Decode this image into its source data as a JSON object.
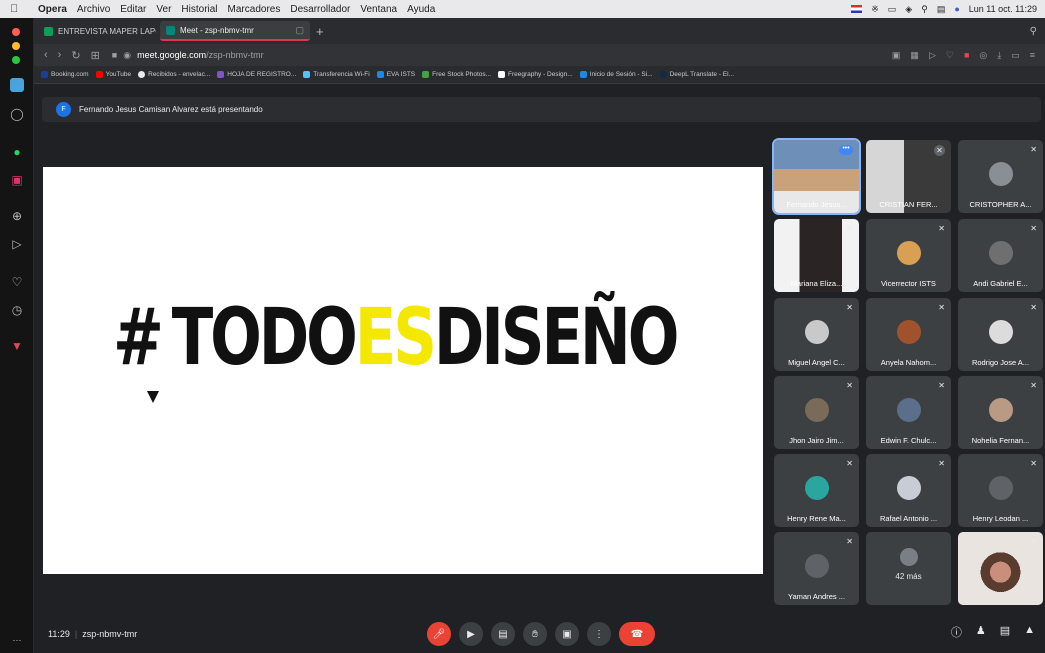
{
  "menubar": {
    "app": "Opera",
    "items": [
      "Archivo",
      "Editar",
      "Ver",
      "Historial",
      "Marcadores",
      "Desarrollador",
      "Ventana",
      "Ayuda"
    ],
    "clock": "Lun 11 oct.  11:29"
  },
  "tabs": [
    {
      "label": "ENTREVISTA MAPER LAPO - G",
      "active": false
    },
    {
      "label": "Meet - zsp-nbmv-tmr",
      "active": true
    }
  ],
  "address": {
    "host": "meet.google.com",
    "path": "/zsp-nbmv-tmr"
  },
  "bookmarks": [
    "Booking.com",
    "YouTube",
    "Recibidos - envelac...",
    "HOJA DE REGISTRO...",
    "Transferencia Wi-Fi",
    "EVA ISTS",
    "Free Stock Photos...",
    "Freegraphy - Design...",
    "Inicio de Sesión - Si...",
    "DeepL Translate - El..."
  ],
  "banner": {
    "initial": "F",
    "text": "Fernando Jesus Camisan Alvarez está presentando"
  },
  "slide": {
    "hash": "#",
    "part1": "TODO",
    "part2": "ES",
    "part3": "DISEÑO"
  },
  "participants": [
    {
      "name": "Fernando Jesus...",
      "type": "video-male",
      "more": "•••"
    },
    {
      "name": "CRISTIAN FER...",
      "type": "video-dark"
    },
    {
      "name": "CRISTOPHER A...",
      "type": "avatar",
      "color": "#8a8f95"
    },
    {
      "name": "Mariana Eliza...",
      "type": "video-female"
    },
    {
      "name": "Vicerrector ISTS",
      "type": "avatar",
      "color": "#d9a055"
    },
    {
      "name": "Andi Gabriel E...",
      "type": "avatar",
      "color": "#6f6f6f"
    },
    {
      "name": "Miguel Angel C...",
      "type": "avatar",
      "color": "#c9c9c9"
    },
    {
      "name": "Anyela Nahom...",
      "type": "avatar",
      "color": "#a0522d"
    },
    {
      "name": "Rodrigo Jose A...",
      "type": "avatar",
      "color": "#dcdcdc"
    },
    {
      "name": "Jhon Jairo Jim...",
      "type": "avatar",
      "color": "#7a6a5a"
    },
    {
      "name": "Edwin F. Chulc...",
      "type": "avatar",
      "color": "#5b6f8a"
    },
    {
      "name": "Nohelia Fernan...",
      "type": "avatar",
      "color": "#b99a85"
    },
    {
      "name": "Henry Rene Ma...",
      "type": "avatar",
      "color": "#2aa5a0"
    },
    {
      "name": "Rafael Antonio ...",
      "type": "avatar",
      "color": "#c8ccd4"
    },
    {
      "name": "Henry Leodan ...",
      "type": "avatar",
      "color": "#5f6368"
    },
    {
      "name": "Yaman Andres ...",
      "type": "avatar",
      "color": "#5f6368"
    },
    {
      "name": "",
      "type": "overflow",
      "count": "42 más"
    },
    {
      "name": "",
      "type": "video-self"
    }
  ],
  "bottombar": {
    "time": "11:29",
    "code": "zsp-nbmv-tmr"
  },
  "colors": {
    "accent_red": "#ea4335",
    "meet_bg": "#202124",
    "tile_bg": "#3c4043",
    "highlight_yellow": "#f5e800"
  },
  "icons": {
    "mic_off": "mic-off-icon",
    "camera": "camera-icon",
    "captions": "captions-icon",
    "hand": "raise-hand-icon",
    "present": "present-icon",
    "more": "more-icon",
    "end_call": "end-call-icon",
    "info": "info-icon",
    "people": "people-icon",
    "chat": "chat-icon",
    "activities": "activities-icon"
  }
}
